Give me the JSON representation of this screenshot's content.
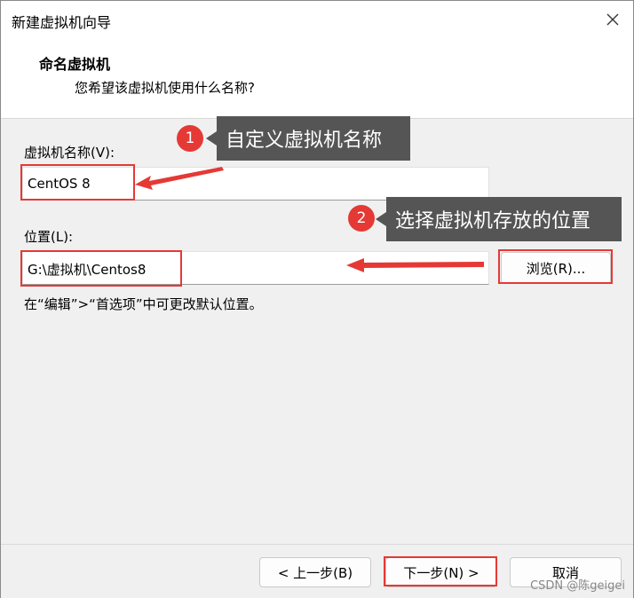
{
  "window": {
    "title": "新建虚拟机向导"
  },
  "header": {
    "title": "命名虚拟机",
    "subtitle": "您希望该虚拟机使用什么名称?"
  },
  "form": {
    "name_label": "虚拟机名称(V):",
    "name_value": "CentOS 8",
    "location_label": "位置(L):",
    "location_value": "G:\\虚拟机\\Centos8",
    "browse_label": "浏览(R)...",
    "hint": "在“编辑”>“首选项”中可更改默认位置。"
  },
  "buttons": {
    "back": "< 上一步(B)",
    "next": "下一步(N) >",
    "cancel": "取消"
  },
  "annotations": {
    "step1_number": "1",
    "step1_text": "自定义虚拟机名称",
    "step2_number": "2",
    "step2_text": "选择虚拟机存放的位置",
    "color": "#e53935"
  },
  "watermark": "CSDN @陈geigei"
}
